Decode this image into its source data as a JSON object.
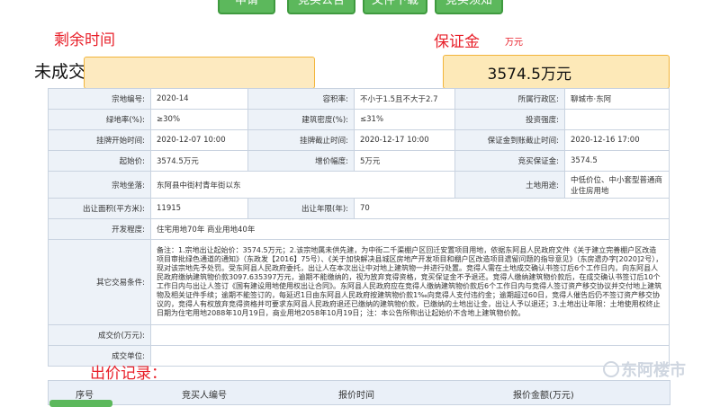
{
  "top_buttons": [
    {
      "label": "申请"
    },
    {
      "label": "竞买公告"
    },
    {
      "label": "文件下载"
    },
    {
      "label": "竞买须知"
    }
  ],
  "countdown": {
    "title": "剩余时间",
    "status": "未成交"
  },
  "deposit": {
    "title": "保证金",
    "unit": "万元",
    "value": "3574.5万元"
  },
  "info": {
    "parcel_no_label": "宗地编号:",
    "parcel_no": "2020-14",
    "far_label": "容积率:",
    "far": "不小于1.5且不大于2.7",
    "district_label": "所属行政区:",
    "district": "聊城市·东阿",
    "green_label": "绿地率(%):",
    "green": "≥30%",
    "density_label": "建筑密度(%):",
    "density": "≤31%",
    "invest_label": "投资强度:",
    "invest": "",
    "start_label": "挂牌开始时间:",
    "start": "2020-12-07 10:00",
    "end_label": "挂牌截止时间:",
    "end": "2020-12-17 10:00",
    "deposit_deadline_label": "保证金到账截止时间:",
    "deposit_deadline": "2020-12-16 17:00",
    "start_price_label": "起始价:",
    "start_price": "3574.5万元",
    "increment_label": "增价幅度:",
    "increment": "5万元",
    "bid_deposit_label": "竞买保证金:",
    "bid_deposit": "3574.5",
    "location_label": "宗地坐落:",
    "location": "东阿县中街村青年街以东",
    "land_use_label": "土地用途:",
    "land_use": "中低价位、中小套型普通商业住房用地",
    "area_label": "出让面积(平方米):",
    "area": "11915",
    "term_label": "出让年限(年):",
    "term": "70",
    "dev_label": "开发程度:",
    "dev": "住宅用地70年 商业用地40年",
    "other_label": "其它交易条件:",
    "other": "备注：1.宗地出让起始价：3574.5万元；2.该宗地属未供先建，为中街二千渠棚户区回迁安置项目用地，依据东阿县人民政府文件《关于建立完善棚户区改造项目审批绿色通道的通知》（东政发【2016】75号）、《关于加快解决县城区房地产开发项目和棚户区改造项目遗留问题的指导意见》（东房遗办字[2020]2号），现对该宗地先予处罚。受东阿县人民政府委托，出让人在本次出让中对地上建筑物一并进行处置。竞得人需在土地成交确认书签订后6个工作日内，向东阿县人民政府缴纳建筑物价款3097.635397万元，逾期不能缴纳的，视为放弃竞得资格，竞买保证金不予退还。竞得人缴纳建筑物价款后，在成交确认书签订后10个工作日内与出让人签订《国有建设用地使用权出让合同》。东阿县人民政府应在竞得人缴纳建筑物价款后6个工作日内与竞得人签订资产移交协议并交付地上建筑物及相关证件手续；逾期不能签订的，每延迟1日由东阿县人民政府按建筑物价款1‰向竞得人支付违约金；逾期超过60日，竞得人催告后仍不签订资产移交协议的，竞得人有权放弃竞得资格并可要求东阿县人民政府退还已缴纳的建筑物价款，已缴纳的土地出让金，出让人予以退还；3.土地出让年限：土地使用权终止日期为住宅用地2088年10月19日，商业用地2058年10月19日；注：本公告所称出让起始价不含地上建筑物价款。",
    "deal_price_label": "成交价(万元):",
    "deal_price": "",
    "deal_unit_label": "成交单位:",
    "deal_unit": ""
  },
  "bids": {
    "title": "出价记录：",
    "columns": [
      "序号",
      "竞买人编号",
      "报价时间",
      "报价金额(万元)"
    ]
  },
  "watermark": "东阿楼市"
}
